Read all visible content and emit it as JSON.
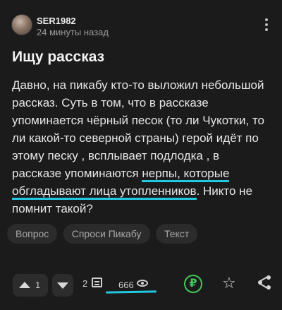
{
  "post": {
    "author": "SER1982",
    "time": "24 минуты назад",
    "title": "Ищу рассказ",
    "body": {
      "p1": "Давно, на пикабу кто-то выложил небольшой рассказ. Суть в том, что в рассказе упоминается чёрный песок (то ли Чукотки, то ли какой-то северной страны) герой идёт по этому песку , всплывает подлодка , в рассказе упоминаются ",
      "h1": "нерпы, которые",
      "sp": " ",
      "h2": "обгладывают лица утопленников",
      "p2": ". Никто не помнит такой?"
    },
    "tags": [
      "Вопрос",
      "Спроси Пикабу",
      "Текст"
    ]
  },
  "footer": {
    "rating": "1",
    "comments": "2",
    "views": "666",
    "donate_symbol": "₽"
  },
  "colors": {
    "background": "#1b1b1b",
    "highlight": "#22c7e0",
    "donate": "#43c65a"
  },
  "icons": [
    "dots-menu-icon",
    "upvote-icon",
    "downvote-icon",
    "comment-icon",
    "eye-icon",
    "ruble-icon",
    "star-icon",
    "share-icon"
  ]
}
